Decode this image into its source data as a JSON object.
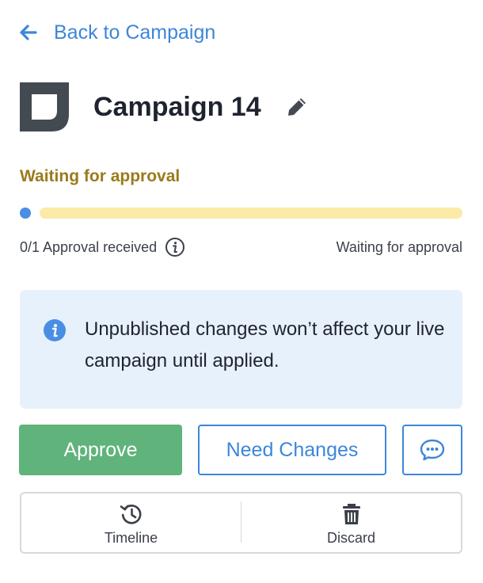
{
  "back_link": {
    "label": "Back to Campaign"
  },
  "campaign": {
    "title": "Campaign 14"
  },
  "status": {
    "heading": "Waiting for approval",
    "progress_fraction": 0,
    "approval_count": "0/1 Approval received",
    "state_label": "Waiting for approval"
  },
  "notice": {
    "icon": "info-icon",
    "text": "Unpublished changes won’t affect your live campaign until applied."
  },
  "actions": {
    "approve_label": "Approve",
    "need_changes_label": "Need Changes",
    "comment_icon": "comment-icon"
  },
  "bottom_bar": {
    "items": [
      {
        "label": "Timeline",
        "icon": "history-icon"
      },
      {
        "label": "Discard",
        "icon": "trash-icon"
      }
    ]
  },
  "colors": {
    "link_blue": "#3d86da",
    "status_gold": "#9b7a1c",
    "progress_track": "#fbeaa8",
    "progress_dot": "#4a8ee4",
    "approve_green": "#5fb37b",
    "notice_bg": "#e7f1fb"
  }
}
